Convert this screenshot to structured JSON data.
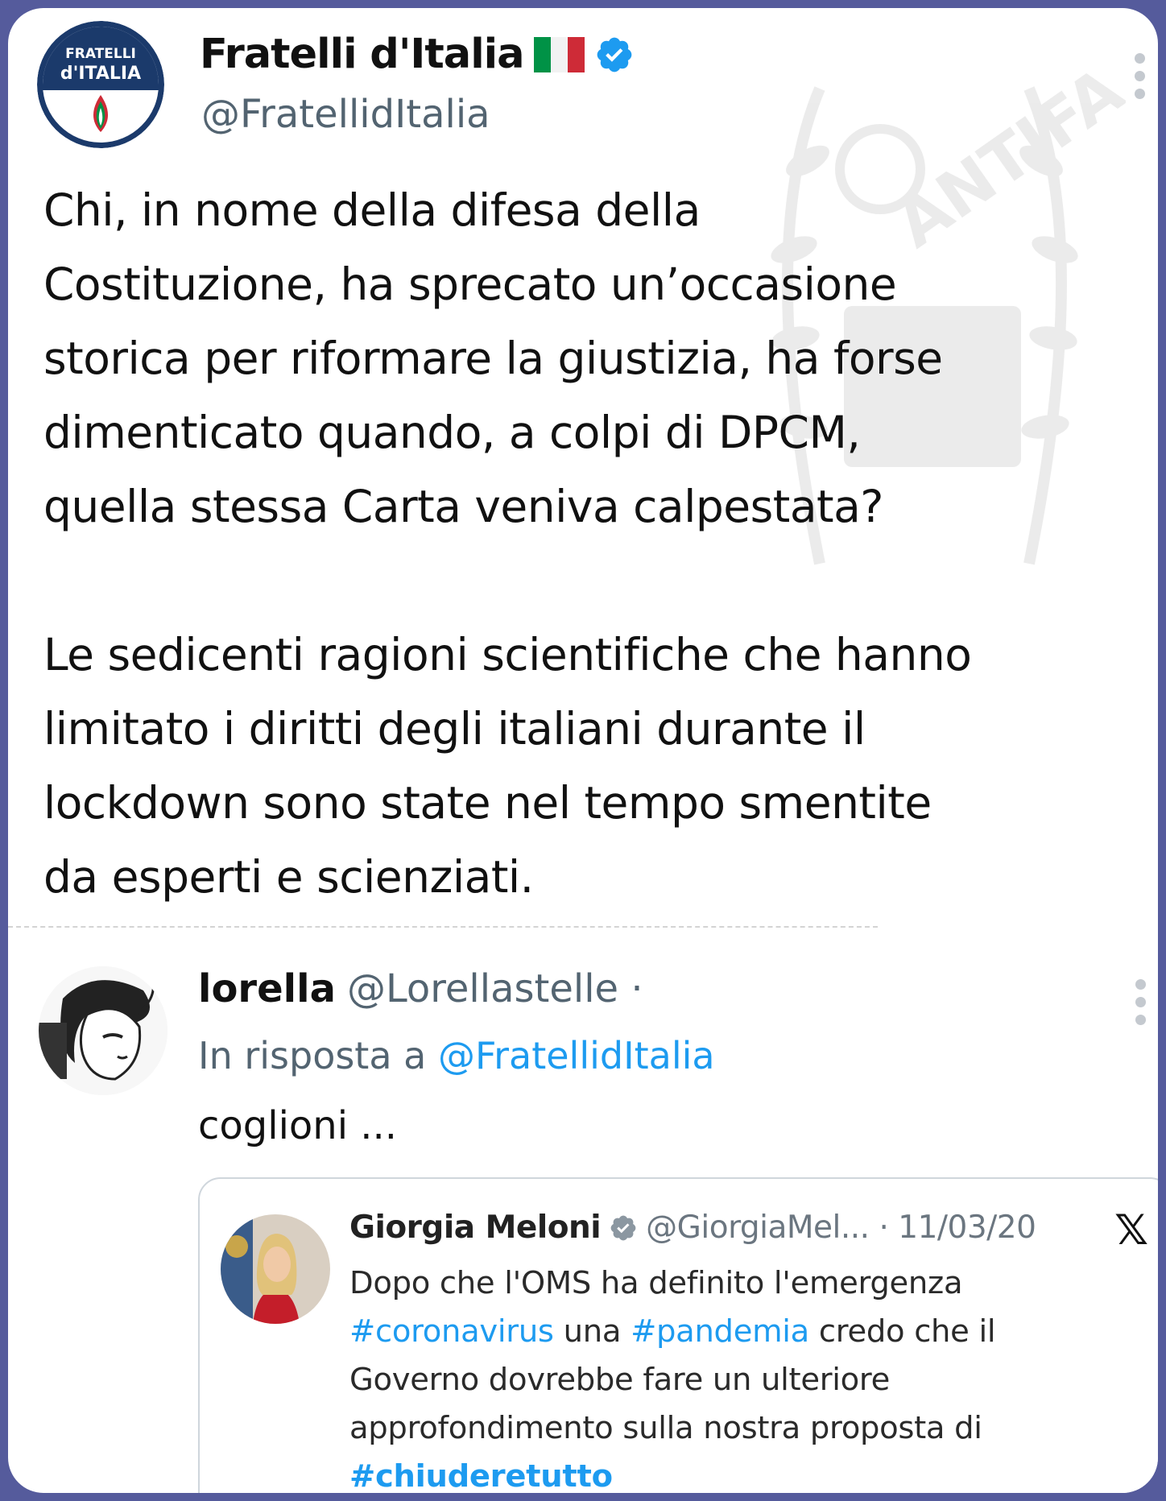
{
  "post": {
    "display_name": "Fratelli d'Italia",
    "handle": "@FratellidItalia",
    "avatar_logo": {
      "line1": "FRATELLI",
      "line2": "d'ITALIA"
    },
    "flag_colors": [
      "#009246",
      "#ffffff",
      "#ce2b37"
    ],
    "verified_color": "#1d9bf0",
    "icons": {
      "verified": "verified-badge-icon",
      "more": "more-options-icon"
    },
    "paragraphs": [
      [
        "Chi, in nome della difesa della",
        "Costituzione, ha sprecato un’occasione",
        "storica per riformare la giustizia, ha forse",
        "dimenticato quando, a colpi di DPCM,",
        "quella stessa Carta veniva calpestata?"
      ],
      [
        "Le sedicenti ragioni scientifiche che hanno",
        "limitato i diritti degli italiani durante il",
        "lockdown sono state nel tempo smentite",
        "da esperti e scienziati."
      ]
    ],
    "watermark_text": "ANTIFA"
  },
  "reply": {
    "display_name": "lorella",
    "handle": "@Lorellastelle ·",
    "in_reply_prefix": "In risposta a",
    "in_reply_link": "@FratellidItalia",
    "text": "coglioni ..."
  },
  "quote": {
    "display_name": "Giorgia Meloni",
    "handle_date": "@GiorgiaMel... · 11/03/20",
    "platform_icon": "x-logo-icon",
    "lines": [
      [
        {
          "t": "Dopo che l'OMS ha definito l'emergenza",
          "h": false
        }
      ],
      [
        {
          "t": "#coronavirus",
          "h": true
        },
        {
          "t": " una ",
          "h": false
        },
        {
          "t": "#pandemia",
          "h": true
        },
        {
          "t": " credo che il",
          "h": false
        }
      ],
      [
        {
          "t": "Governo dovrebbe fare un ulteriore",
          "h": false
        }
      ],
      [
        {
          "t": "approfondimento sulla nostra proposta di",
          "h": false
        }
      ],
      [
        {
          "t": "#chiuderetutto",
          "h": true,
          "bold": true
        }
      ]
    ]
  }
}
